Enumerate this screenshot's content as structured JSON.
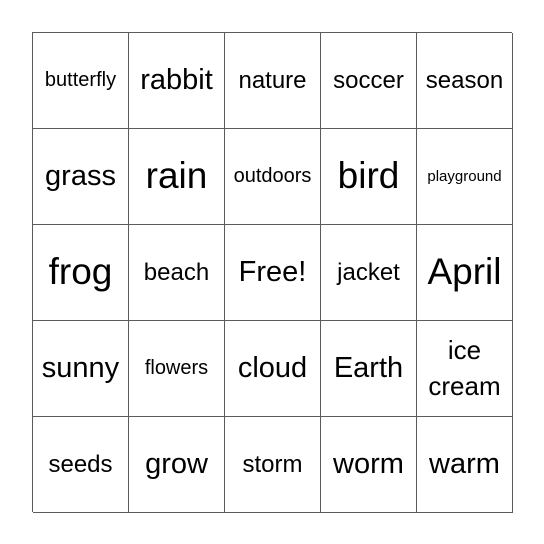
{
  "board": {
    "cells": [
      {
        "text": "butterfly",
        "size": "s-s"
      },
      {
        "text": "rabbit",
        "size": "s-l"
      },
      {
        "text": "nature",
        "size": "s-m"
      },
      {
        "text": "soccer",
        "size": "s-m"
      },
      {
        "text": "season",
        "size": "s-m"
      },
      {
        "text": "grass",
        "size": "s-l"
      },
      {
        "text": "rain",
        "size": "s-xl"
      },
      {
        "text": "outdoors",
        "size": "s-s"
      },
      {
        "text": "bird",
        "size": "s-xl"
      },
      {
        "text": "playground",
        "size": "s-xs"
      },
      {
        "text": "frog",
        "size": "s-xl"
      },
      {
        "text": "beach",
        "size": "s-m"
      },
      {
        "text": "Free!",
        "size": "s-l"
      },
      {
        "text": "jacket",
        "size": "s-m"
      },
      {
        "text": "April",
        "size": "s-xl"
      },
      {
        "text": "sunny",
        "size": "s-l"
      },
      {
        "text": "flowers",
        "size": "s-s"
      },
      {
        "text": "cloud",
        "size": "s-l"
      },
      {
        "text": "Earth",
        "size": "s-l"
      },
      {
        "text": "ice cream",
        "size": "s-wrap"
      },
      {
        "text": "seeds",
        "size": "s-m"
      },
      {
        "text": "grow",
        "size": "s-l"
      },
      {
        "text": "storm",
        "size": "s-m"
      },
      {
        "text": "worm",
        "size": "s-l"
      },
      {
        "text": "warm",
        "size": "s-l"
      }
    ]
  }
}
